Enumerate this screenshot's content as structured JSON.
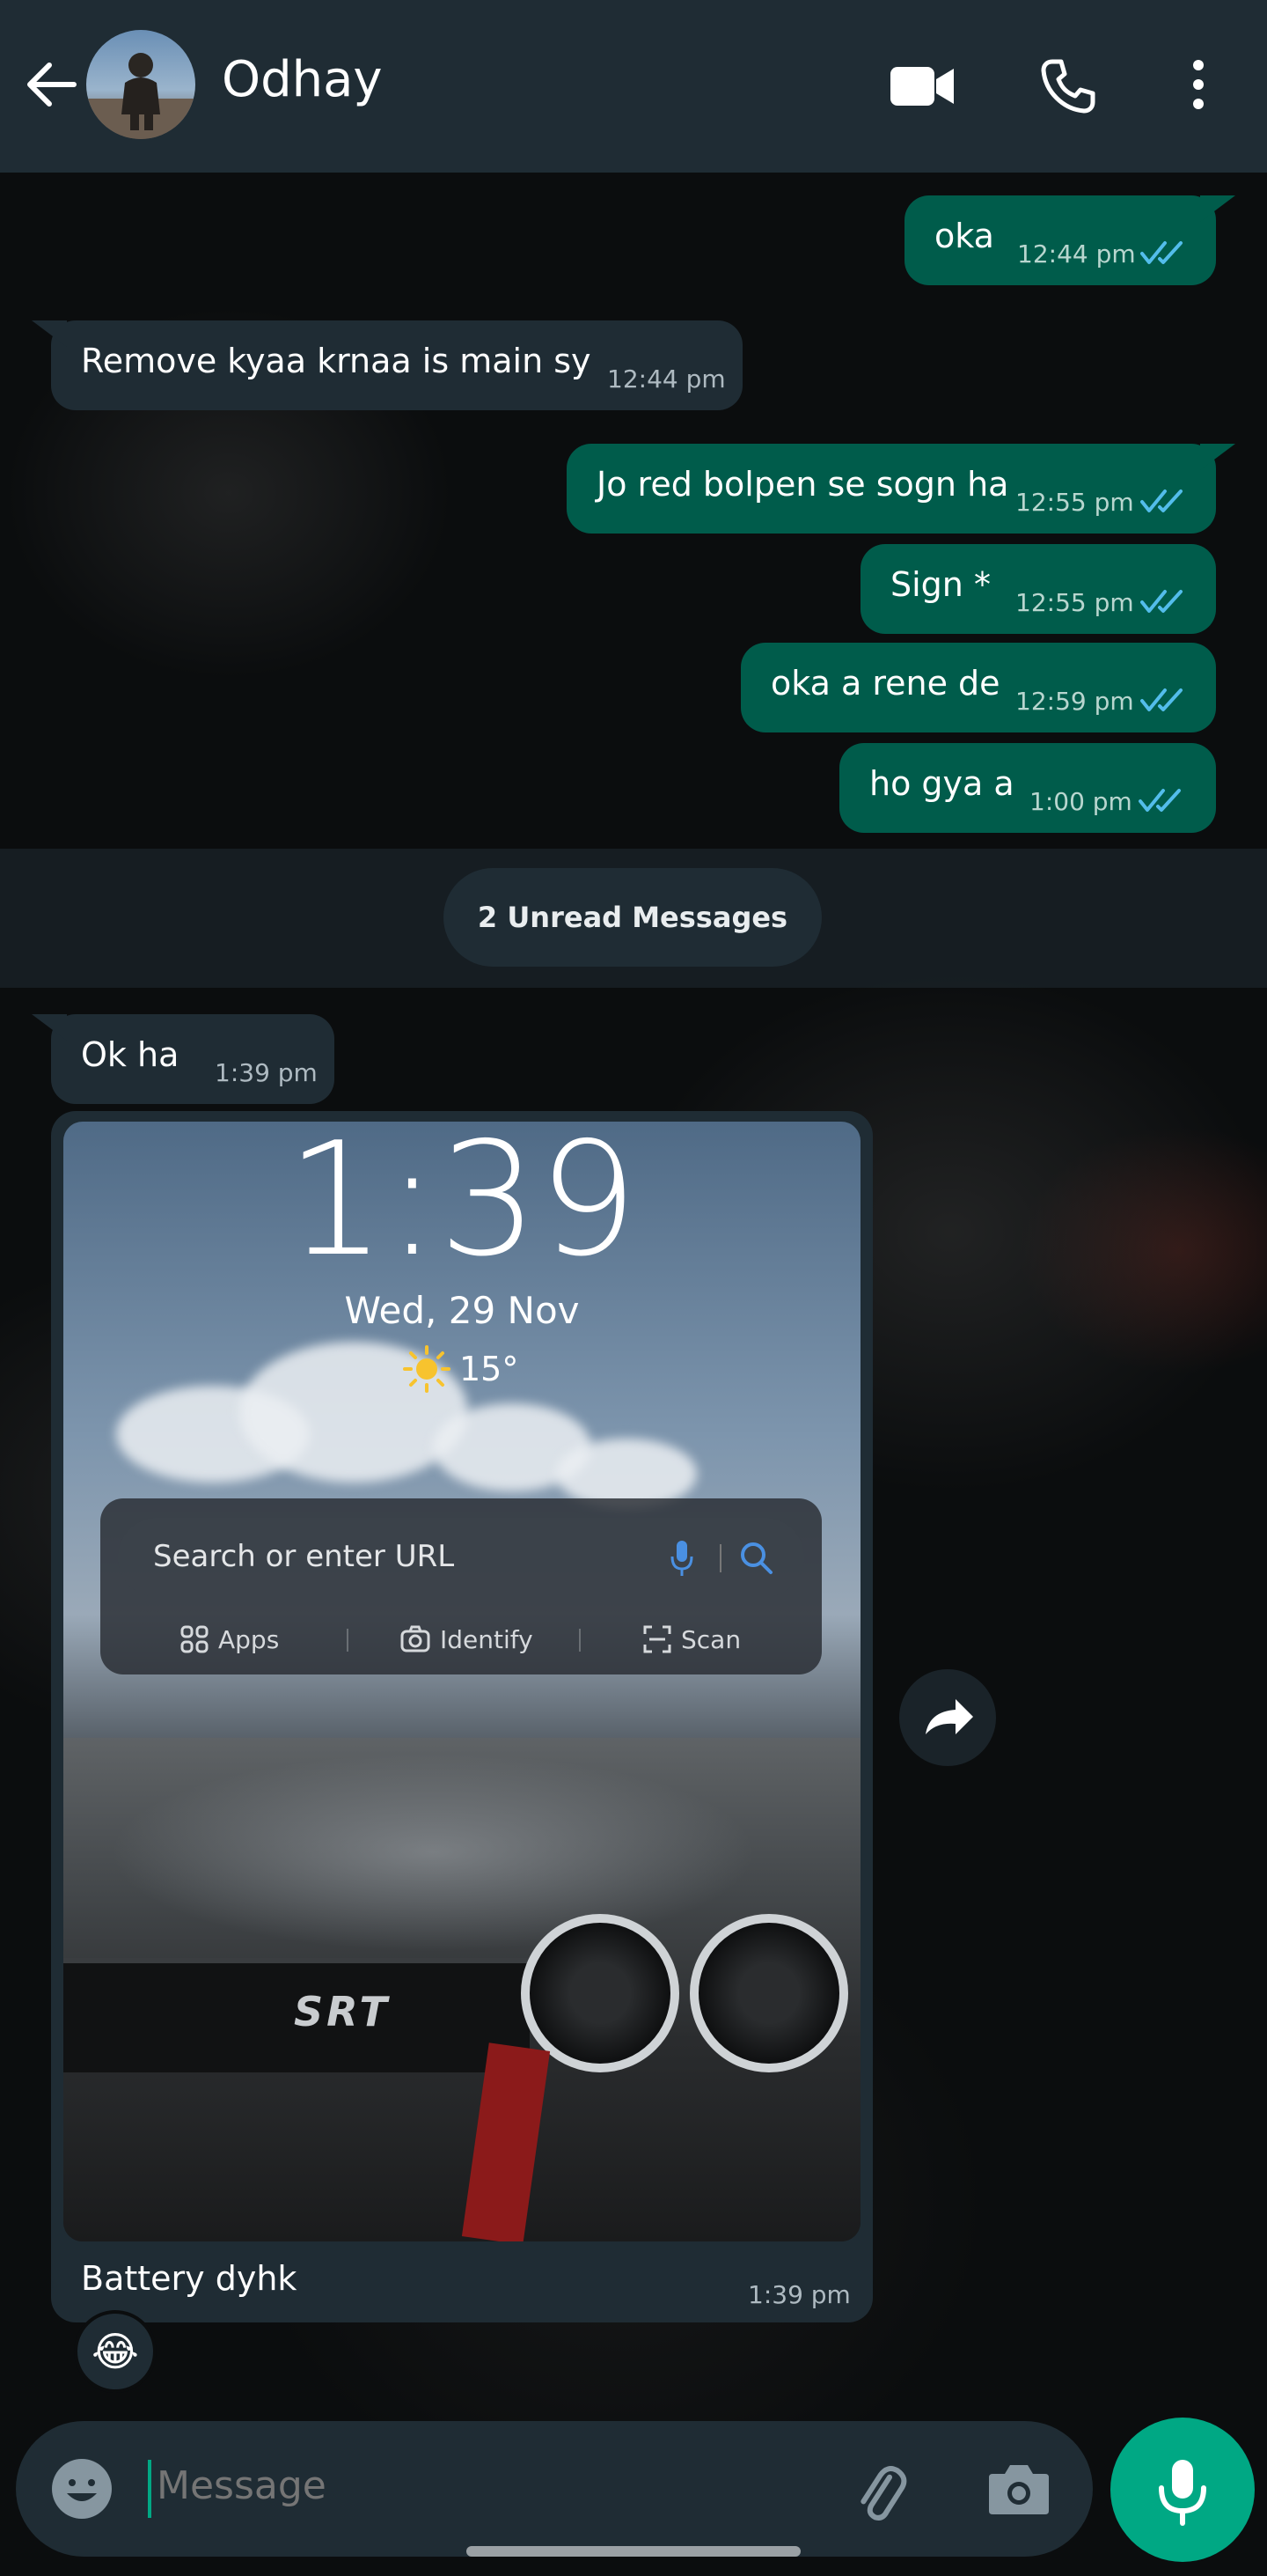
{
  "header": {
    "contact_name": "Odhay",
    "icons": [
      "back-arrow-icon",
      "avatar",
      "video-call-icon",
      "voice-call-icon",
      "more-options-icon"
    ]
  },
  "messages": [
    {
      "direction": "out",
      "text": "oka",
      "time": "12:44 pm",
      "status": "read"
    },
    {
      "direction": "in",
      "text": "Remove kyaa krnaa is main sy",
      "time": "12:44 pm"
    },
    {
      "direction": "out",
      "text": "Jo red bolpen se sogn ha",
      "time": "12:55 pm",
      "status": "read"
    },
    {
      "direction": "out",
      "text": "Sign *",
      "time": "12:55 pm",
      "status": "read"
    },
    {
      "direction": "out",
      "text": "oka a rene de",
      "time": "12:59 pm",
      "status": "read"
    },
    {
      "direction": "out",
      "text": "ho gya a",
      "time": "1:00 pm",
      "status": "read"
    }
  ],
  "unread_divider": "2 Unread Messages",
  "incoming_after": {
    "text": "Ok ha",
    "time": "1:39 pm"
  },
  "image_message": {
    "caption": "Battery dyhk",
    "time": "1:39 pm",
    "reaction": "😂",
    "screenshot": {
      "lock_time": "1:39",
      "lock_date": "Wed, 29 Nov",
      "weather_temp": "15°",
      "search_placeholder": "Search or enter URL",
      "quick_actions": [
        "Apps",
        "Identify",
        "Scan"
      ],
      "badge_text": "SRT"
    }
  },
  "composer": {
    "placeholder": "Message"
  },
  "colors": {
    "header_bg": "#1f2c34",
    "outgoing_bubble": "#005c4b",
    "incoming_bubble": "#1f2c34",
    "accent": "#00a884",
    "read_ticks": "#53bdeb"
  }
}
